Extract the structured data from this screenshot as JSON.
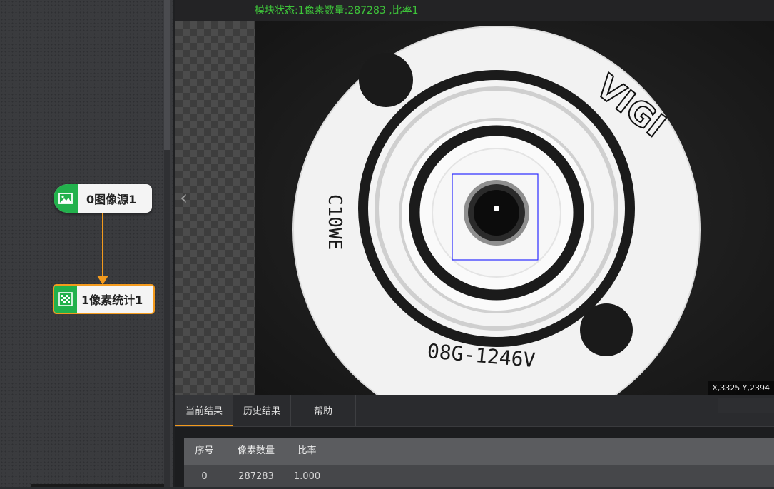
{
  "flow": {
    "nodes": [
      {
        "label": "0图像源1",
        "icon": "image-icon"
      },
      {
        "label": "1像素统计1",
        "icon": "pixel-stat-icon"
      }
    ]
  },
  "viewer": {
    "status_text": "模块状态:1像素数量:287283 ,比率1",
    "coordinates": "X,3325  Y,2394",
    "part_markings": [
      "VIGI",
      "C10WE",
      "08G-1246V"
    ]
  },
  "results": {
    "tabs": [
      "当前结果",
      "历史结果",
      "帮助"
    ],
    "active_tab": "当前结果",
    "columns": [
      "序号",
      "像素数量",
      "比率"
    ],
    "rows": [
      [
        "0",
        "287283",
        "1.000"
      ]
    ]
  },
  "colors": {
    "accent": "#f39a1d",
    "node_green": "#22b14c",
    "status_green": "#3ec43a",
    "roi_blue": "#2a2aff"
  }
}
